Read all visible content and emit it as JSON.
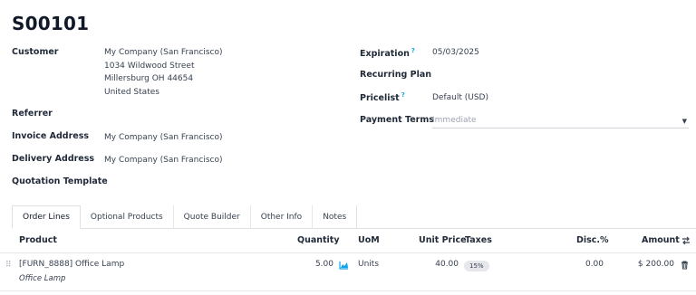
{
  "record": {
    "title": "S00101"
  },
  "left_fields": {
    "customer_label": "Customer",
    "customer_lines": [
      "My Company (San Francisco)",
      "1034 Wildwood Street",
      "Millersburg OH 44654",
      "United States"
    ],
    "referrer_label": "Referrer",
    "invoice_label": "Invoice Address",
    "invoice_value": "My Company (San Francisco)",
    "delivery_label": "Delivery Address",
    "delivery_value": "My Company (San Francisco)",
    "template_label": "Quotation Template"
  },
  "right_fields": {
    "expiration_label": "Expiration",
    "expiration_value": "05/03/2025",
    "recurring_label": "Recurring Plan",
    "pricelist_label": "Pricelist",
    "pricelist_value": "Default (USD)",
    "payment_label": "Payment Terms",
    "payment_placeholder": "Immediate",
    "help_mark": "?"
  },
  "tabs": [
    {
      "label": "Order Lines",
      "active": true
    },
    {
      "label": "Optional Products",
      "active": false
    },
    {
      "label": "Quote Builder",
      "active": false
    },
    {
      "label": "Other Info",
      "active": false
    },
    {
      "label": "Notes",
      "active": false
    }
  ],
  "table": {
    "headers": {
      "product": "Product",
      "quantity": "Quantity",
      "uom": "UoM",
      "unit_price": "Unit Price",
      "taxes": "Taxes",
      "disc": "Disc.%",
      "amount": "Amount"
    },
    "rows": [
      {
        "product": "[FURN_8888] Office Lamp",
        "description": "Office Lamp",
        "quantity": "5.00",
        "uom": "Units",
        "unit_price": "40.00",
        "tax": "15%",
        "disc": "0.00",
        "amount": "$ 200.00"
      }
    ]
  },
  "icons": {
    "forecast": "chart-area-icon",
    "delete": "trash-icon",
    "columns": "optional-columns-icon",
    "drag": "drag-handle-icon"
  },
  "colors": {
    "help": "#0ea5e9",
    "forecast": "#0ea5e9"
  }
}
